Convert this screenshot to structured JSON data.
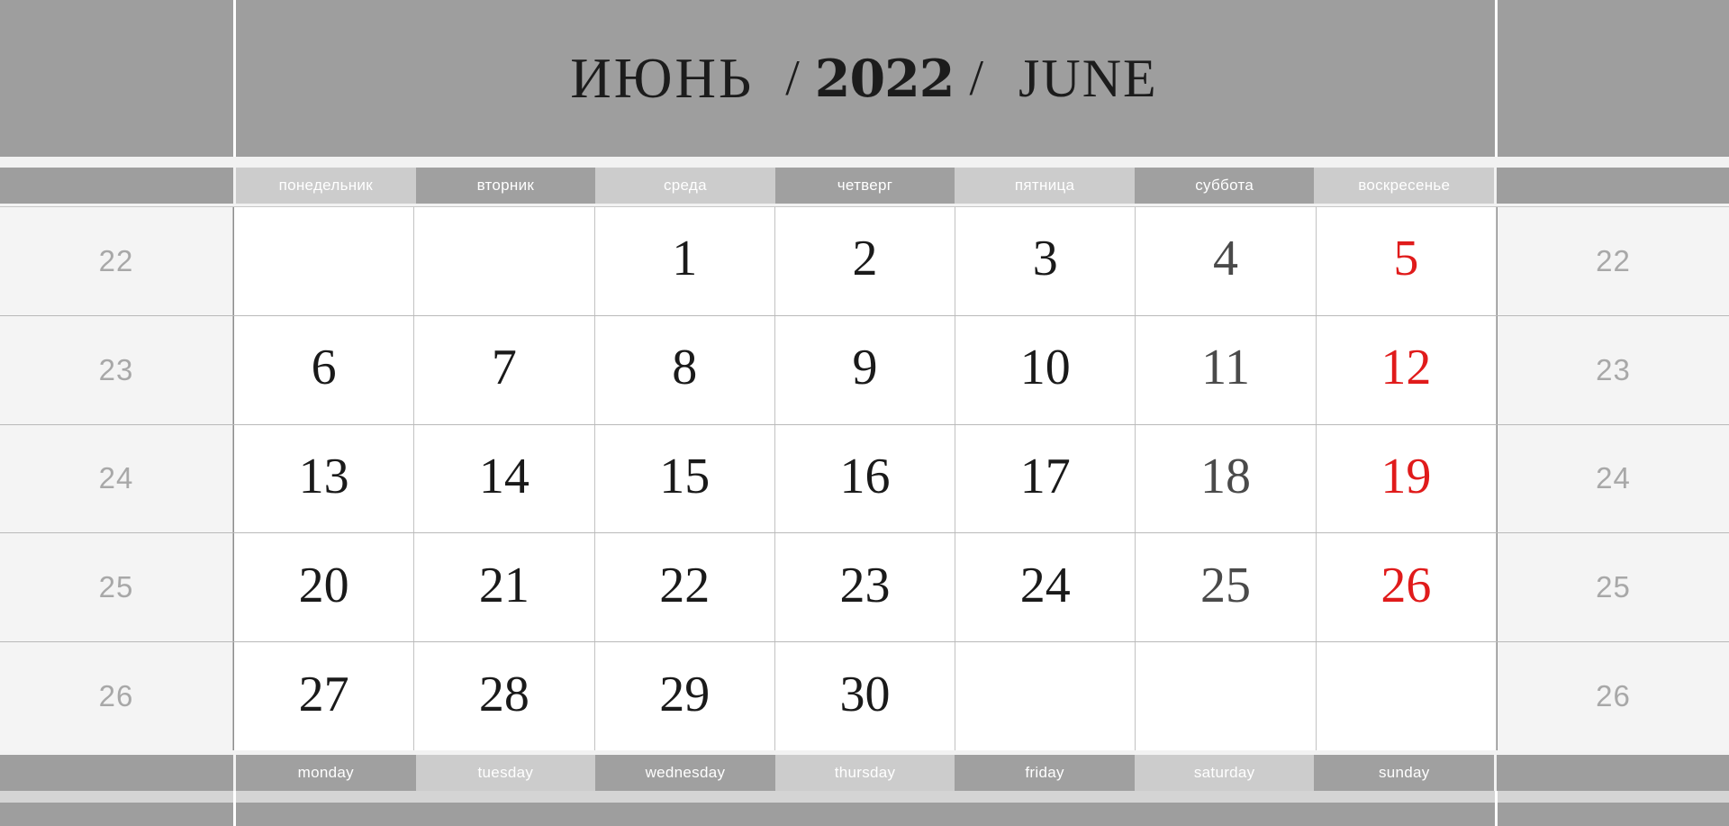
{
  "header": {
    "month_ru": "ИЮНЬ",
    "separator": "/",
    "year": "2022",
    "month_en": "JUNE"
  },
  "weekdays_ru": [
    "понедельник",
    "вторник",
    "среда",
    "четверг",
    "пятница",
    "суббота",
    "воскресенье"
  ],
  "weekdays_en": [
    "monday",
    "tuesday",
    "wednesday",
    "thursday",
    "friday",
    "saturday",
    "sunday"
  ],
  "week_numbers": [
    "22",
    "23",
    "24",
    "25",
    "26"
  ],
  "weeks": [
    {
      "week_number": "22",
      "days": [
        "",
        "",
        "1",
        "2",
        "3",
        "4",
        "5"
      ]
    },
    {
      "week_number": "23",
      "days": [
        "6",
        "7",
        "8",
        "9",
        "10",
        "11",
        "12"
      ]
    },
    {
      "week_number": "24",
      "days": [
        "13",
        "14",
        "15",
        "16",
        "17",
        "18",
        "19"
      ]
    },
    {
      "week_number": "25",
      "days": [
        "20",
        "21",
        "22",
        "23",
        "24",
        "25",
        "26"
      ]
    },
    {
      "week_number": "26",
      "days": [
        "27",
        "28",
        "29",
        "30",
        "",
        "",
        ""
      ]
    }
  ],
  "colors": {
    "band_gray": "#9e9e9e",
    "weekday_light": "#cccccc",
    "weekday_dark": "#a0a0a0",
    "weeknum_bg": "#f4f4f4",
    "weeknum_text": "#a8a8a8",
    "day_text": "#1a1a1a",
    "saturday_text": "#4a4a4a",
    "sunday_text": "#e01b1b",
    "cell_bg": "#ffffff",
    "strip": "#f2f2f2",
    "bottom_light": "#d4d4d4"
  }
}
